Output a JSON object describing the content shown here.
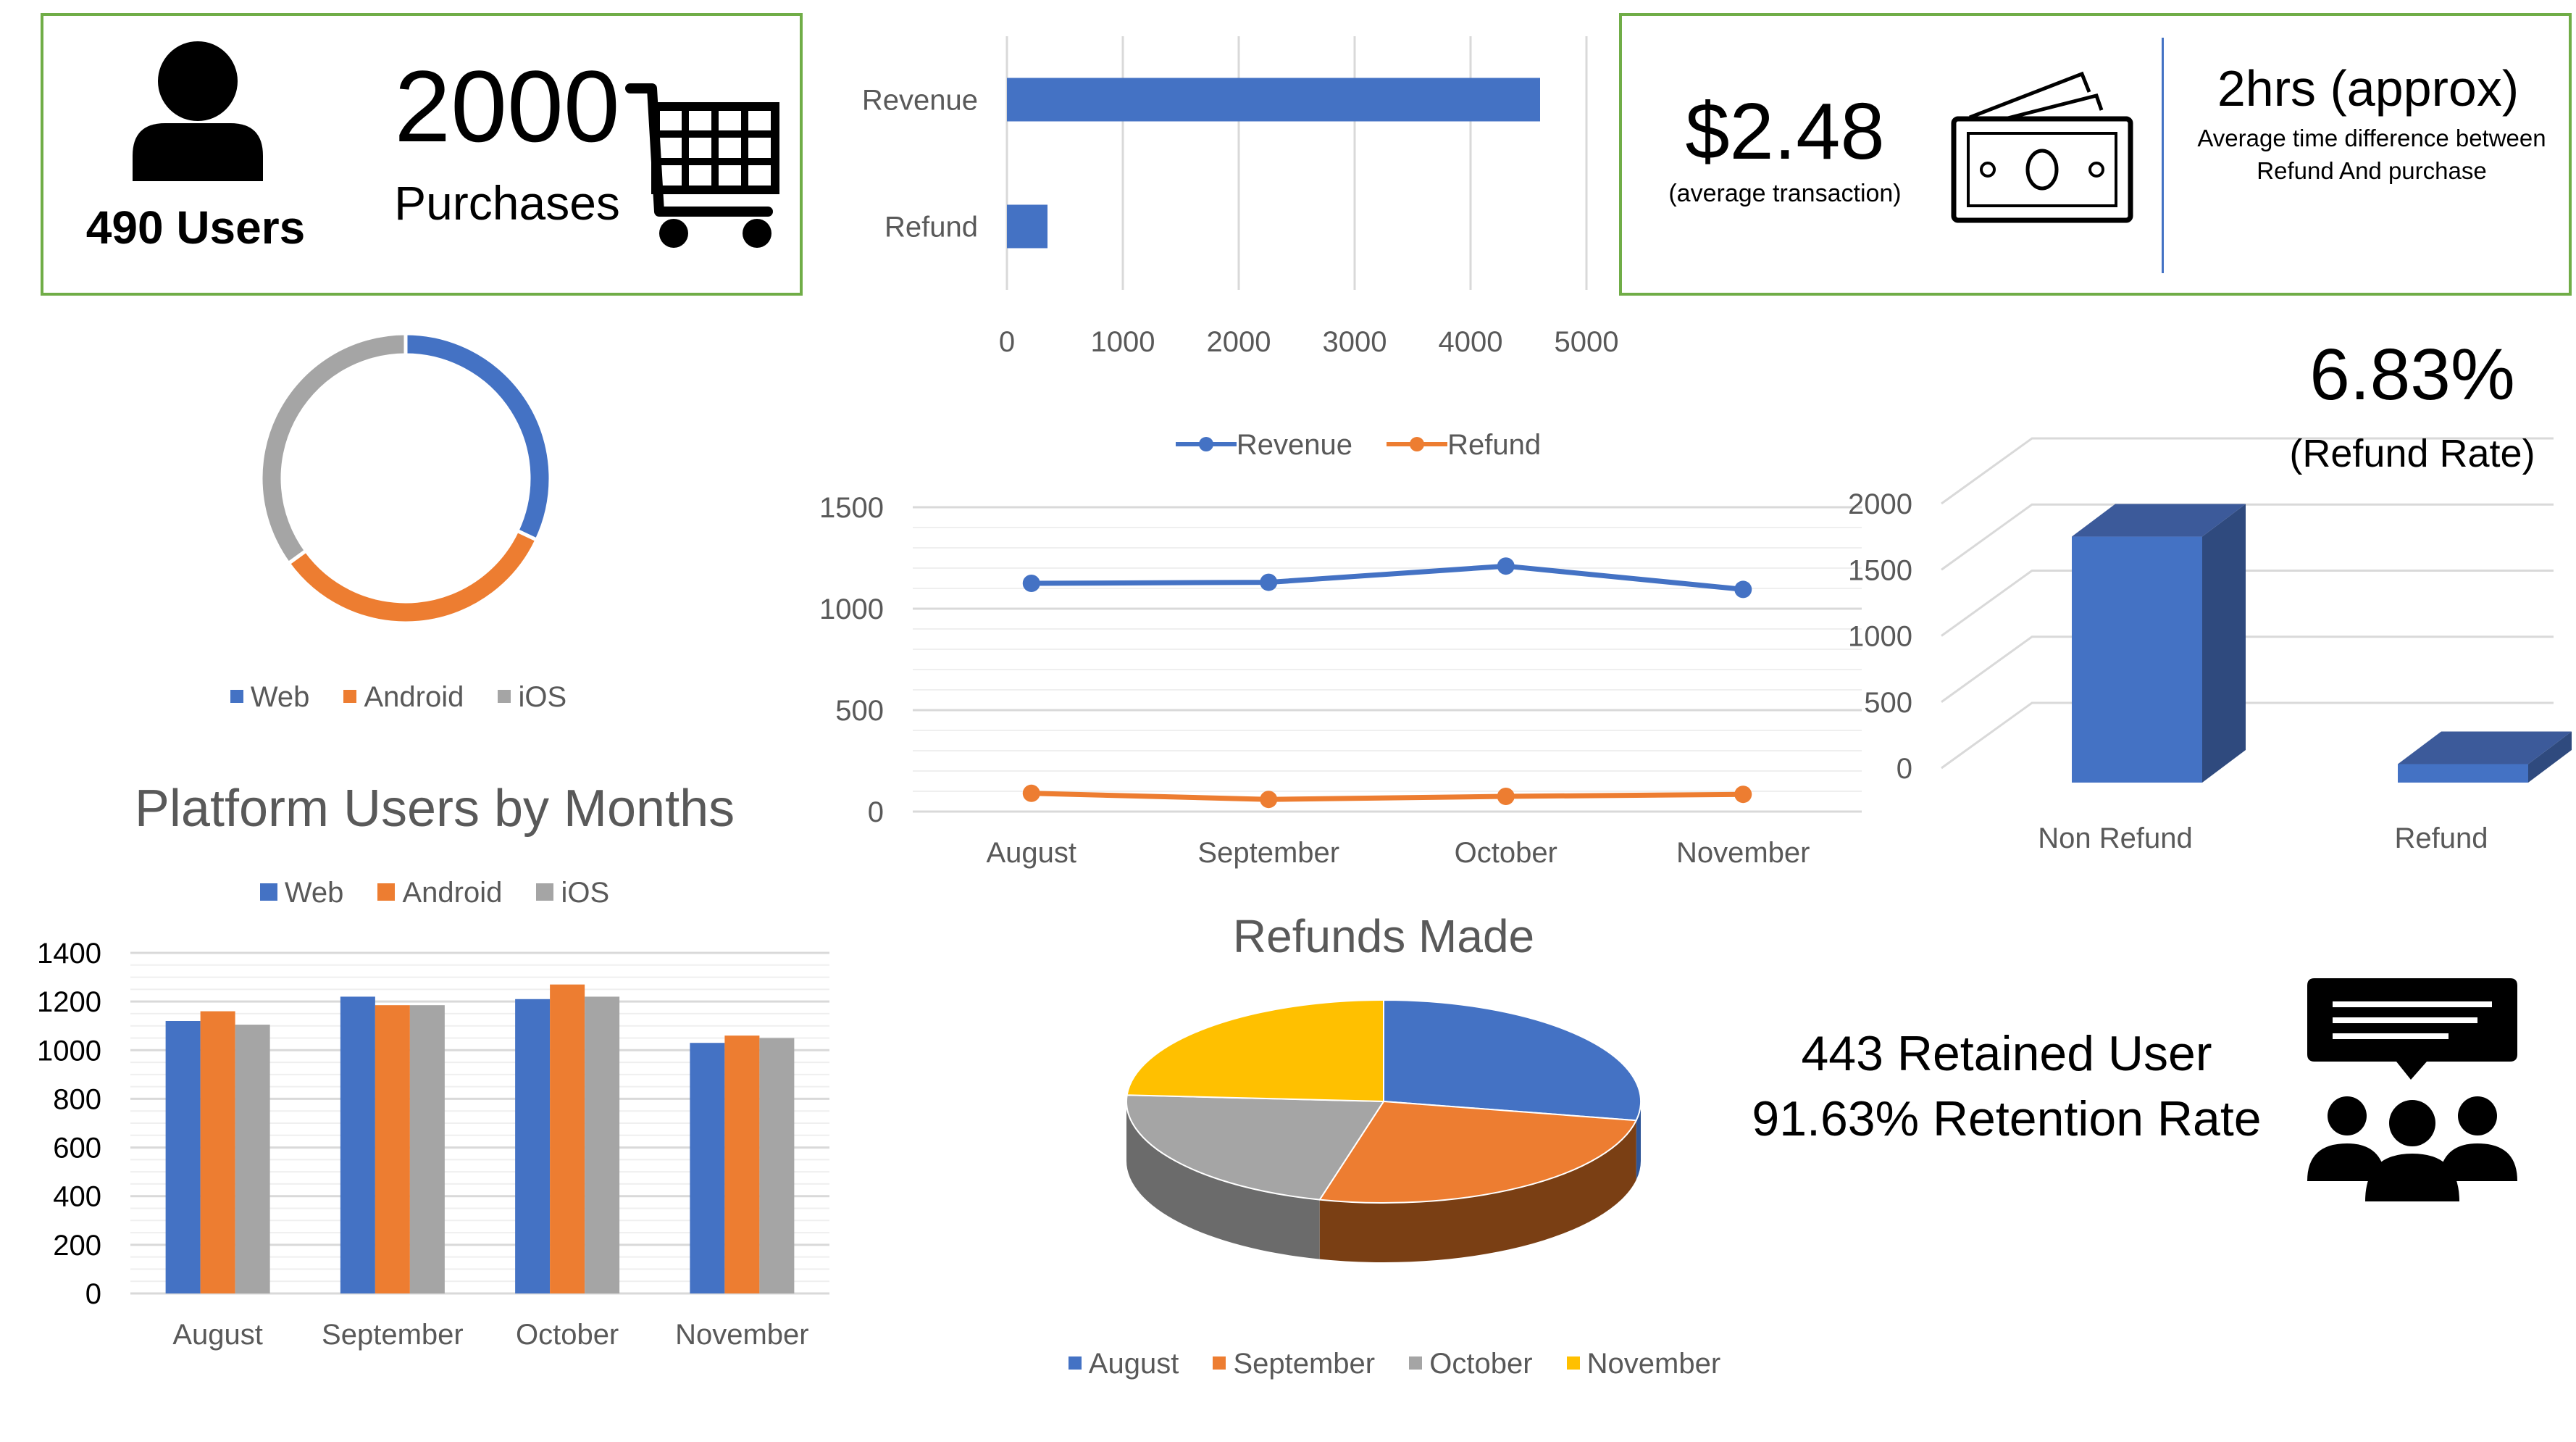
{
  "kpi_users": {
    "count_text": "490 Users",
    "purchases_number": "2000",
    "purchases_label": "Purchases"
  },
  "kpi_transaction": {
    "amount": "$2.48",
    "amount_caption": "(average transaction)",
    "time": "2hrs (approx)",
    "time_caption_line1": "Average time difference between",
    "time_caption_line2": "Refund And purchase"
  },
  "refund_rate": {
    "value": "6.83%",
    "label": "(Refund Rate)"
  },
  "retention": {
    "line1": "443 Retained User",
    "line2": "91.63% Retention Rate"
  },
  "colors": {
    "blue": "#4472c4",
    "orange": "#ed7d31",
    "gray": "#a5a5a5",
    "yellow": "#ffc000",
    "box_border": "#70ad47"
  },
  "icons": {
    "user": "user-icon",
    "cart": "shopping-cart-icon",
    "money": "banknote-icon",
    "chat": "chat-group-icon"
  },
  "chart_data": [
    {
      "id": "revenue_refund_bar",
      "type": "bar",
      "orientation": "horizontal",
      "title": "",
      "categories": [
        "Revenue",
        "Refund"
      ],
      "values": [
        4600,
        350
      ],
      "xlim": [
        0,
        5000
      ],
      "xticks": [
        "0",
        "1000",
        "2000",
        "3000",
        "4000",
        "5000"
      ],
      "grid": true
    },
    {
      "id": "platform_donut",
      "type": "pie",
      "style": "donut",
      "title": "",
      "categories": [
        "Web",
        "Android",
        "iOS"
      ],
      "values": [
        32,
        33,
        35
      ],
      "legend": "bottom"
    },
    {
      "id": "monthly_revenue_refund_line",
      "type": "line",
      "title": "",
      "categories": [
        "August",
        "September",
        "October",
        "November"
      ],
      "series": [
        {
          "name": "Revenue",
          "values": [
            1125,
            1130,
            1210,
            1095
          ]
        },
        {
          "name": "Refund",
          "values": [
            90,
            60,
            75,
            85
          ]
        }
      ],
      "ylim": [
        0,
        1500
      ],
      "yticks": [
        "0",
        "500",
        "1000",
        "1500"
      ],
      "legend": "top",
      "grid": true
    },
    {
      "id": "refund_3d_bar",
      "type": "bar",
      "style": "3d",
      "title": "",
      "categories": [
        "Non Refund",
        "Refund"
      ],
      "values": [
        1860,
        140
      ],
      "ylim": [
        0,
        2000
      ],
      "yticks": [
        "0",
        "500",
        "1000",
        "1500",
        "2000"
      ]
    },
    {
      "id": "platform_users_by_months",
      "type": "bar",
      "title": "Platform Users by Months",
      "categories": [
        "August",
        "September",
        "October",
        "November"
      ],
      "series": [
        {
          "name": "Web",
          "values": [
            1120,
            1220,
            1210,
            1030
          ]
        },
        {
          "name": "Android",
          "values": [
            1160,
            1185,
            1270,
            1060
          ]
        },
        {
          "name": "iOS",
          "values": [
            1105,
            1185,
            1220,
            1050
          ]
        }
      ],
      "ylim": [
        0,
        1400
      ],
      "yticks": [
        "0",
        "200",
        "400",
        "600",
        "800",
        "1000",
        "1200",
        "1400"
      ],
      "legend": "top",
      "grid": true
    },
    {
      "id": "refunds_made_pie",
      "type": "pie",
      "style": "3d",
      "title": "Refunds Made",
      "categories": [
        "August",
        "September",
        "October",
        "November"
      ],
      "values": [
        28,
        26,
        22,
        24
      ],
      "legend": "bottom"
    }
  ]
}
